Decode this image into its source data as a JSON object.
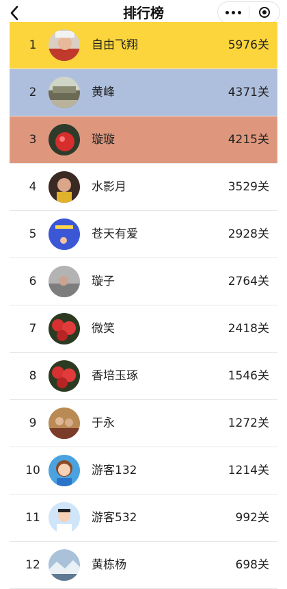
{
  "header": {
    "title": "排行榜"
  },
  "colors": {
    "gold": "#fbd53b",
    "silver": "#aebfdd",
    "bronze": "#de977d"
  },
  "rows": [
    {
      "rank": "1",
      "name": "自由飞翔",
      "score": "5976关",
      "avatar_icon": "avatar-man-photo"
    },
    {
      "rank": "2",
      "name": "黄峰",
      "score": "4371关",
      "avatar_icon": "avatar-landscape-photo"
    },
    {
      "rank": "3",
      "name": "璇璇",
      "score": "4215关",
      "avatar_icon": "avatar-red-flower-photo"
    },
    {
      "rank": "4",
      "name": "水影月",
      "score": "3529关",
      "avatar_icon": "avatar-woman-photo"
    },
    {
      "rank": "5",
      "name": "苍天有爱",
      "score": "2928关",
      "avatar_icon": "avatar-blue-text-image"
    },
    {
      "rank": "6",
      "name": "璇子",
      "score": "2764关",
      "avatar_icon": "avatar-person-photo"
    },
    {
      "rank": "7",
      "name": "微笑",
      "score": "2418关",
      "avatar_icon": "avatar-red-flowers-photo"
    },
    {
      "rank": "8",
      "name": "香培玉琢",
      "score": "1546关",
      "avatar_icon": "avatar-red-flowers-photo"
    },
    {
      "rank": "9",
      "name": "于永",
      "score": "1272关",
      "avatar_icon": "avatar-family-photo"
    },
    {
      "rank": "10",
      "name": "游客132",
      "score": "1214关",
      "avatar_icon": "avatar-cartoon-woman"
    },
    {
      "rank": "11",
      "name": "游客532",
      "score": "992关",
      "avatar_icon": "avatar-cartoon-man"
    },
    {
      "rank": "12",
      "name": "黄栋杨",
      "score": "698关",
      "avatar_icon": "avatar-snow-landscape-photo"
    }
  ]
}
